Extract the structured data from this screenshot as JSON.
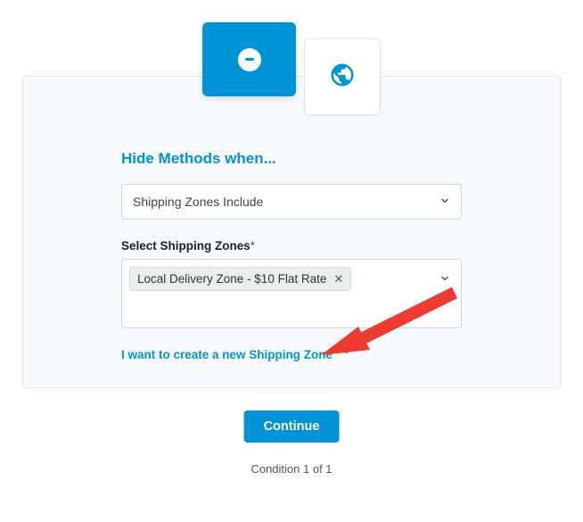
{
  "cards": {
    "primary_icon": "minus",
    "secondary_icon": "globe"
  },
  "heading": "Hide Methods when...",
  "condition_dropdown": {
    "value": "Shipping Zones Include"
  },
  "zones": {
    "label": "Select Shipping Zones",
    "required_marker": "*",
    "selected": [
      "Local Delivery Zone - $10 Flat Rate"
    ]
  },
  "create_link": "I want to create a new Shipping Zone",
  "continue_label": "Continue",
  "counter": "Condition 1 of 1"
}
